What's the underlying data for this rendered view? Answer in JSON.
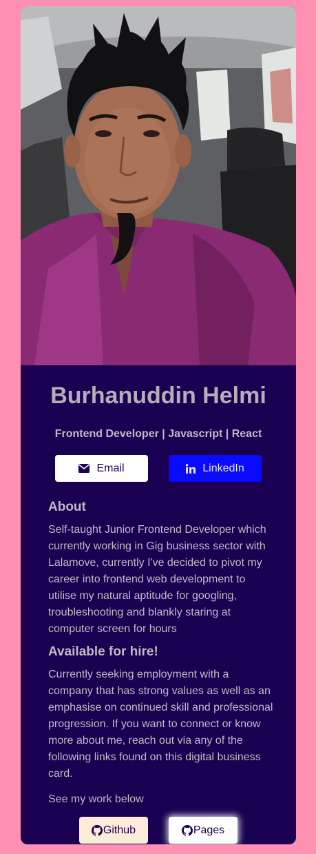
{
  "profile": {
    "name": "Burhanuddin Helmi",
    "tagline": "Frontend Developer | Javascript | React",
    "photo_alt": "Profile photo"
  },
  "contact": {
    "email_label": "Email",
    "linkedin_label": "LinkedIn"
  },
  "about": {
    "title": "About",
    "text": "Self-taught Junior Frontend Developer which currently working in Gig business sector with Lalamove, currently I've decided to pivot my career into frontend web development to utilise my natural aptitude for googling, troubleshooting and blankly staring at computer screen for hours"
  },
  "hire": {
    "title": "Available for hire!",
    "text": "Currently seeking employment with a company that has strong values as well as an emphasise on continued skill and professional progression. If you want to connect or know more about me, reach out via any of the following links found on this digital business card."
  },
  "work": {
    "text": "See my work below",
    "github_label": "Github",
    "pages_label": "Pages"
  },
  "colors": {
    "page_background": "#ff8fb3",
    "card_background": "#1a0050",
    "linkedin_blue": "#0a0aff",
    "github_button": "#fdecd7"
  },
  "icons": {
    "email": "envelope-icon",
    "linkedin": "linkedin-icon",
    "github": "github-icon",
    "pages": "github-icon"
  }
}
